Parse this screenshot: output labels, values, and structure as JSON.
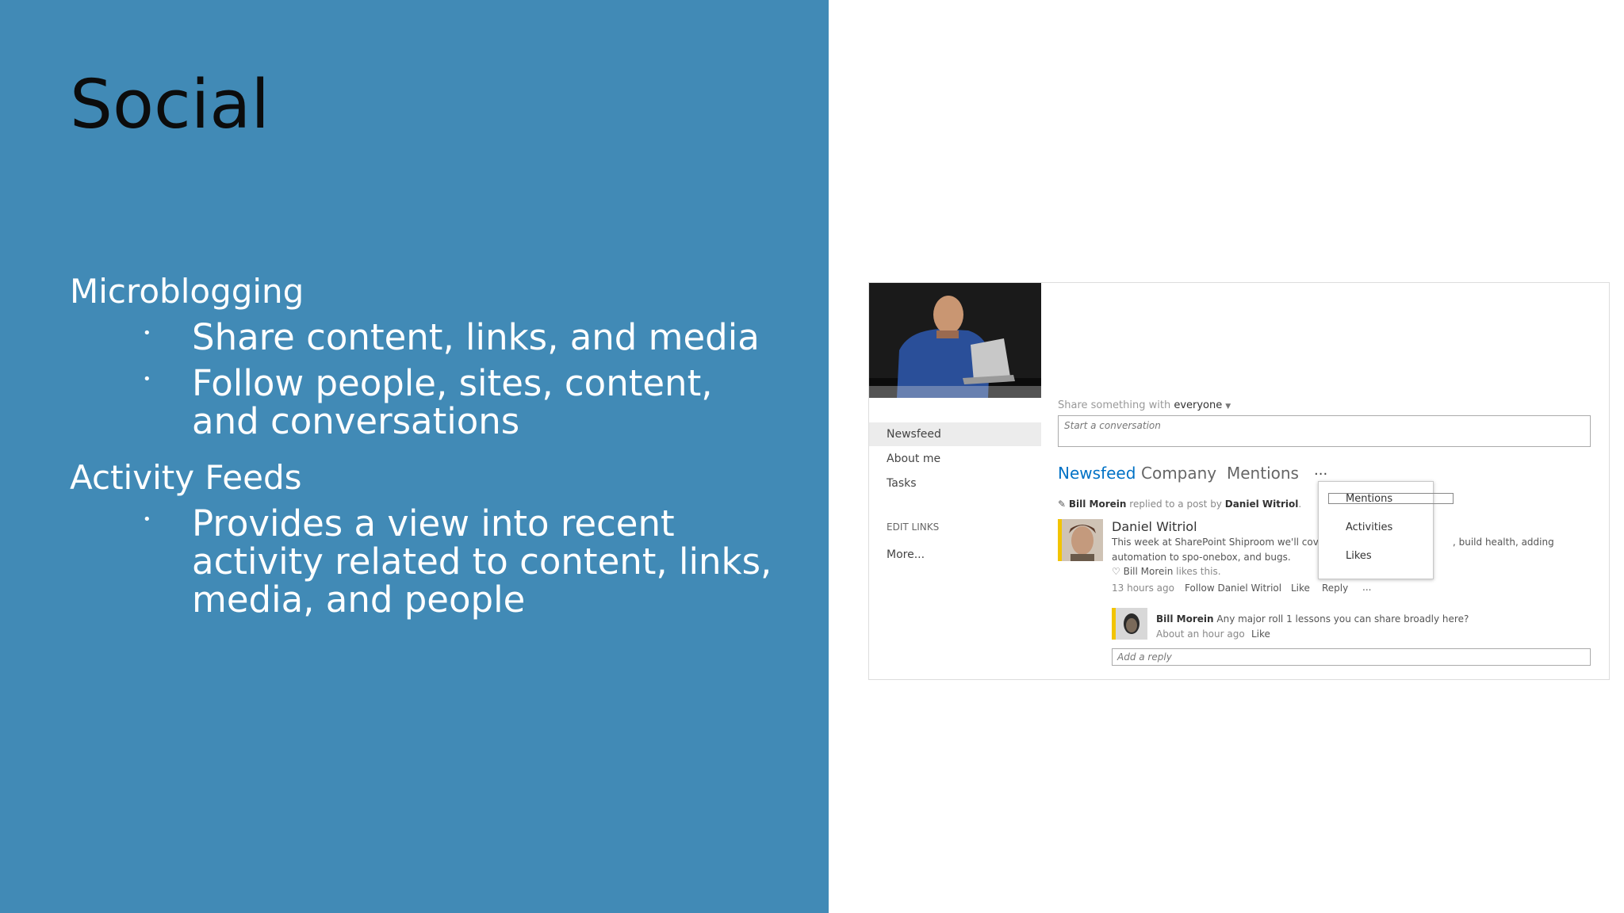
{
  "slide": {
    "title": "Social",
    "sections": [
      {
        "heading": "Microblogging",
        "bullets": [
          "Share content, links, and media",
          "Follow people, sites, content, and conversations"
        ]
      },
      {
        "heading": "Activity Feeds",
        "bullets": [
          "Provides a view into recent activity related to content, links, media, and people"
        ]
      }
    ],
    "colors": {
      "left_panel": "#418ab6",
      "title": "#0c0c0c",
      "text": "#ffffff"
    }
  },
  "screenshot": {
    "nav": {
      "items": [
        "Newsfeed",
        "About me",
        "Tasks"
      ],
      "edit_links": "EDIT LINKS",
      "more": "More..."
    },
    "share": {
      "prefix": "Share something with",
      "audience": "everyone",
      "placeholder": "Start a conversation"
    },
    "tabs": [
      "Newsfeed",
      "Company",
      "Mentions"
    ],
    "tabs_more": "...",
    "dropdown": [
      "Mentions",
      "Activities",
      "Likes"
    ],
    "post": {
      "header_user": "Bill Morein",
      "header_middle": "replied to a post by",
      "header_target": "Daniel Witriol",
      "author": "Daniel Witriol",
      "body_line1": "This week at SharePoint Shiproom we'll cover l",
      "body_line1_right": ", build health, adding",
      "body_line2": "automation to spo-onebox, and bugs.",
      "likes_user": "Bill Morein",
      "likes_suffix": "likes this.",
      "time": "13 hours ago",
      "follow": "Follow Daniel Witriol",
      "like": "Like",
      "reply": "Reply",
      "more": "..."
    },
    "reply": {
      "author": "Bill Morein",
      "text": "Any major roll 1 lessons you can share broadly here?",
      "time": "About an hour ago",
      "like": "Like"
    },
    "reply_placeholder": "Add a reply",
    "colors": {
      "accent": "#0072c6",
      "presence": "#f2c400"
    }
  }
}
